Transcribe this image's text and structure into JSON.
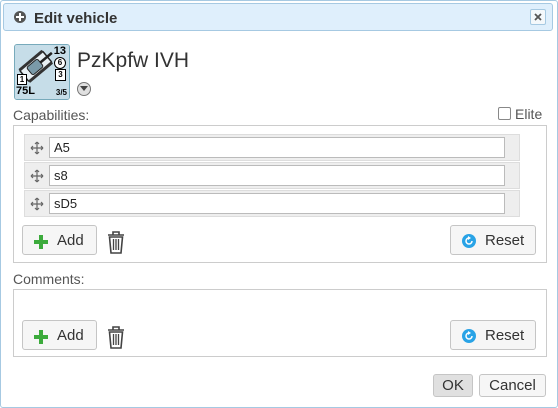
{
  "dialog": {
    "title": "Edit vehicle",
    "vehicle_name": "PzKpfw IVH",
    "counter": {
      "top_right": "13",
      "circle": "6",
      "box": "3",
      "left_box": "1",
      "gun": "75L",
      "fraction": "3/5"
    },
    "capabilities": {
      "label": "Capabilities:",
      "elite_label": "Elite",
      "items": [
        "A5",
        "s8",
        "sD5"
      ],
      "add_label": "Add",
      "reset_label": "Reset"
    },
    "comments": {
      "label": "Comments:",
      "add_label": "Add",
      "reset_label": "Reset"
    },
    "ok_label": "OK",
    "cancel_label": "Cancel"
  },
  "colors": {
    "titlebar_bg": "#dfeffc",
    "border": "#a6c9e2",
    "add_icon": "#3cab3c",
    "reset_icon": "#29a3e6"
  },
  "icons": [
    "dialog-icon",
    "close-icon",
    "dropdown-icon",
    "drag-handle-icon",
    "plus-icon",
    "trash-icon",
    "reset-icon"
  ]
}
